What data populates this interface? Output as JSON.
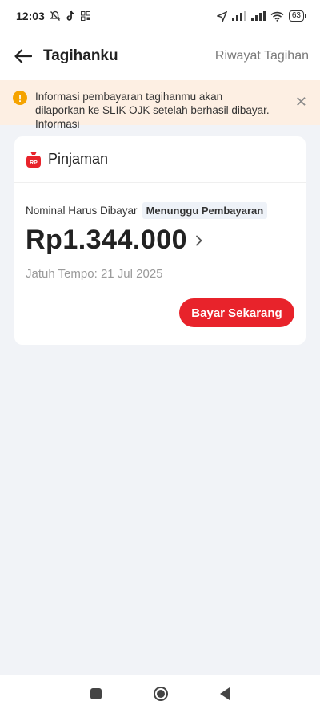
{
  "status_bar": {
    "time": "12:03",
    "battery": "63"
  },
  "header": {
    "title": "Tagihanku",
    "history_link": "Riwayat Tagihan"
  },
  "banner": {
    "text": "Informasi pembayaran tagihanmu akan dilaporkan ke SLIK OJK setelah berhasil dibayar. Informasi",
    "warning_symbol": "!",
    "close_symbol": "✕"
  },
  "card": {
    "title": "Pinjaman",
    "icon_text": "RP",
    "nominal_label": "Nominal Harus Dibayar",
    "status": "Menunggu Pembayaran",
    "amount": "Rp1.344.000",
    "due": "Jatuh Tempo: 21 Jul 2025",
    "pay_button": "Bayar Sekarang"
  },
  "colors": {
    "accent": "#e8232b",
    "banner_bg": "#fdefe3",
    "warning": "#f5a300"
  }
}
